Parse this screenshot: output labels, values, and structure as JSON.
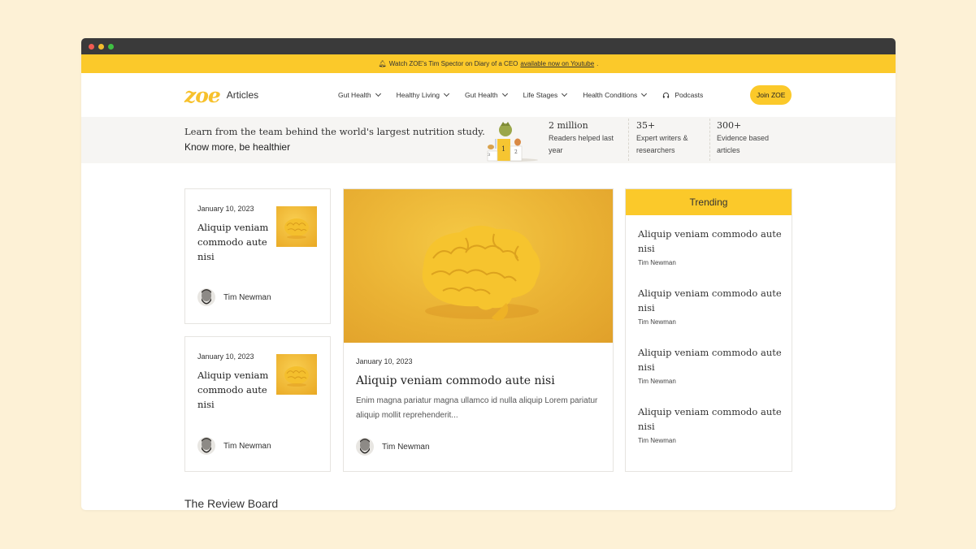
{
  "announcement": {
    "text": "Watch ZOE's Tim Spector on Diary of a CEO",
    "link": "available now on Youtube",
    "end": "."
  },
  "header": {
    "logo": "ZOE",
    "section": "Articles",
    "nav": [
      {
        "label": "Gut Health",
        "dropdown": true
      },
      {
        "label": "Healthy Living",
        "dropdown": true
      },
      {
        "label": "Gut Health",
        "dropdown": true
      },
      {
        "label": "Life Stages",
        "dropdown": true
      },
      {
        "label": "Health Conditions",
        "dropdown": true
      }
    ],
    "podcasts": "Podcasts",
    "join": "Join ZOE"
  },
  "hero": {
    "title": "Learn from the team behind the world's largest nutrition study.",
    "subtitle": "Know more, be healthier",
    "podium": {
      "first": "1",
      "second": "2",
      "third": "3"
    },
    "stats": [
      {
        "value": "2 million",
        "line1": "Readers helped last",
        "line2": "year"
      },
      {
        "value": "35+",
        "line1": "Expert writers &",
        "line2": "researchers"
      },
      {
        "value": "300+",
        "line1": "Evidence based",
        "line2": "articles"
      }
    ]
  },
  "cards": [
    {
      "date": "January 10, 2023",
      "title_lines": [
        "Aliquip veniam",
        "commodo aute",
        "nisi"
      ],
      "author": "Tim Newman"
    },
    {
      "date": "January 10, 2023",
      "title_lines": [
        "Aliquip veniam",
        "commodo aute",
        "nisi"
      ],
      "author": "Tim Newman"
    }
  ],
  "feature": {
    "date": "January 10, 2023",
    "title": "Aliquip veniam commodo aute nisi",
    "excerpt": "Enim magna pariatur magna ullamco id nulla aliquip Lorem pariatur aliquip mollit reprehenderit...",
    "author": "Tim Newman"
  },
  "trending": {
    "heading": "Trending",
    "items": [
      {
        "line1": "Aliquip veniam commodo aute",
        "line2": "nisi",
        "author": "Tim Newman"
      },
      {
        "line1": "Aliquip veniam commodo aute",
        "line2": "nisi",
        "author": "Tim Newman"
      },
      {
        "line1": "Aliquip veniam commodo aute",
        "line2": "nisi",
        "author": "Tim Newman"
      },
      {
        "line1": "Aliquip veniam commodo aute",
        "line2": "nisi",
        "author": "Tim Newman"
      }
    ]
  },
  "review_board": "The Review Board",
  "colors": {
    "accent": "#fbc92a",
    "logo": "#f7c12c",
    "background": "#fdf1d6"
  }
}
